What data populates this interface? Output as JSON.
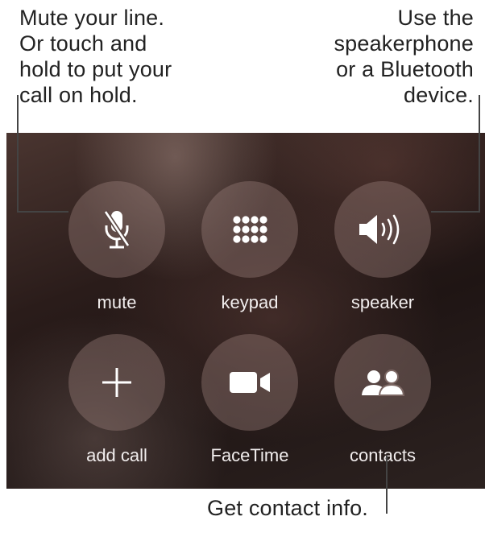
{
  "callouts": {
    "mute": {
      "lines": [
        "Mute your line.",
        "Or touch and",
        "hold to put your",
        "call on hold."
      ]
    },
    "speaker": {
      "lines": [
        "Use the",
        "speakerphone",
        "or a Bluetooth",
        "device."
      ]
    },
    "contacts": {
      "lines": [
        "Get contact info."
      ]
    }
  },
  "call_controls": {
    "buttons": [
      {
        "label": "mute",
        "icon": "mute-microphone-icon"
      },
      {
        "label": "keypad",
        "icon": "keypad-icon"
      },
      {
        "label": "speaker",
        "icon": "speaker-icon"
      },
      {
        "label": "add call",
        "icon": "plus-icon"
      },
      {
        "label": "FaceTime",
        "icon": "video-camera-icon"
      },
      {
        "label": "contacts",
        "icon": "contacts-icon"
      }
    ]
  },
  "colors": {
    "button_fill": "#967d78",
    "label_text": "#f2eeee",
    "callout_text": "#222222"
  }
}
